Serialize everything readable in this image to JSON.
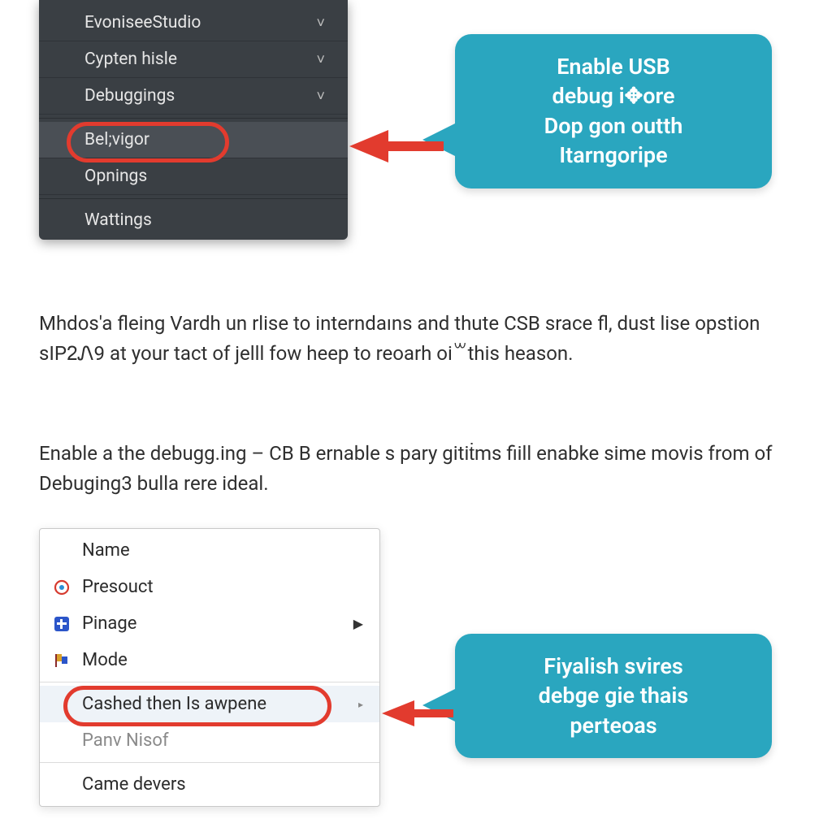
{
  "dark_menu": {
    "items": [
      {
        "label": "EvoniseeStudio",
        "has_chevron": true
      },
      {
        "label": "Cypten hisle",
        "has_chevron": true
      },
      {
        "label": "Debuggings",
        "has_chevron": true
      },
      {
        "label": "Bel;vigor",
        "highlighted": true
      },
      {
        "label": "Opnings"
      },
      {
        "label": "Wattings"
      }
    ]
  },
  "callouts": {
    "c1_line1": "Enable USB",
    "c1_line2": "debug i✥ore",
    "c1_line3": "Dop gon outth",
    "c1_line4": "Itarngoripe",
    "c2_line1": "Fiyalish svires",
    "c2_line2": "debge gie thais",
    "c2_line3": "perteoas"
  },
  "paragraphs": {
    "p1": "Mhdos'a fleing Vardh un rlise to interndaıns and thute CSB srace fl, dust lise opstion sIPᒿᏁ9 at your tact of jelll fow heep to reoarh oi꒳this heason.",
    "p2": "Enable a the debugg.ing – CB B ernable s pary gitiṫms fiill enabke sime movis from of Debuging3 bulla rere ideal."
  },
  "light_menu": {
    "header": "Name",
    "items": [
      {
        "label": "Presouct",
        "icon": "target-icon",
        "icon_color": "#d63b2f"
      },
      {
        "label": "Pinage",
        "icon": "plus-icon",
        "icon_color": "#2b55c9",
        "has_submenu": true
      },
      {
        "label": "Mode",
        "icon": "flag-icon",
        "icon_color": "#d9a12b"
      },
      {
        "label": "Cashed then Is awpene",
        "highlighted": true,
        "has_submenu_small": true
      },
      {
        "label": "Panv Nisof",
        "muted": true
      },
      {
        "label": "Came devers"
      }
    ]
  },
  "colors": {
    "callout_bg": "#2aa6bf",
    "highlight_red": "#e23b2e"
  }
}
